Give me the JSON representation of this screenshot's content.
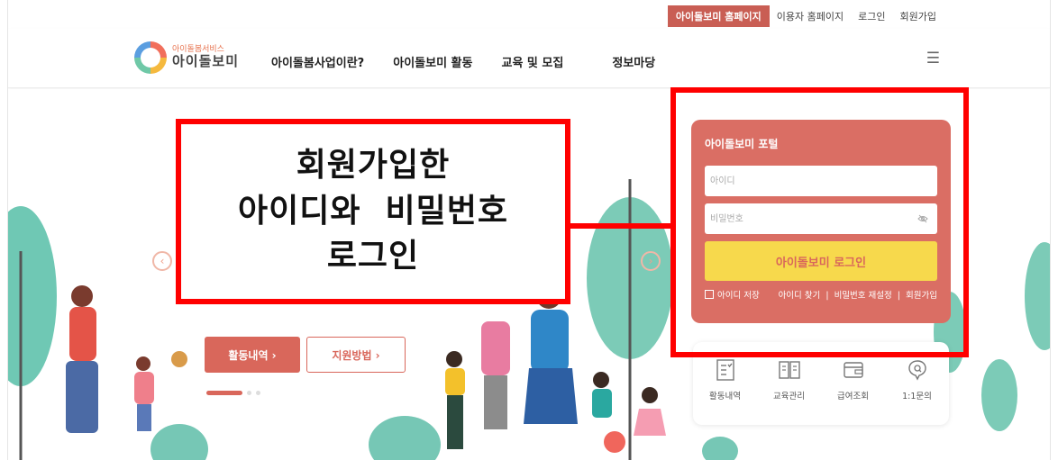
{
  "utility": {
    "active": "아이돌보미 홈페이지",
    "links": [
      "이용자 홈페이지",
      "로그인",
      "회원가입"
    ]
  },
  "header": {
    "logo_sub": "아이돌봄서비스",
    "logo_main": "아이돌보미",
    "nav": [
      "아이돌봄사업이란?",
      "아이돌보미 활동",
      "교육 및 모집",
      "정보마당"
    ],
    "menu_icon": "hamburger-icon"
  },
  "hero": {
    "btn_activity": "활동내역 ›",
    "btn_support": "지원방법 ›"
  },
  "annotation": {
    "lines": [
      "회원가입한",
      "아이디와  비밀번호",
      "로그인"
    ]
  },
  "portal": {
    "title": "아이돌보미 포털",
    "id_placeholder": "아이디",
    "pw_placeholder": "비밀번호",
    "login_button": "아이돌보미 로그인",
    "save_id": "아이디 저장",
    "find_id": "아이디 찾기",
    "reset_pw": "비밀번호 재설정",
    "join": "회원가입",
    "sep": "|"
  },
  "quick_menu": [
    {
      "label": "활동내역",
      "icon": "checklist-icon"
    },
    {
      "label": "교육관리",
      "icon": "book-icon"
    },
    {
      "label": "급여조회",
      "icon": "wallet-icon"
    },
    {
      "label": "1:1문의",
      "icon": "inquiry-icon"
    }
  ],
  "colors": {
    "brand": "#d9675b",
    "login_button": "#f7d94c",
    "annotation": "#ff0000"
  }
}
